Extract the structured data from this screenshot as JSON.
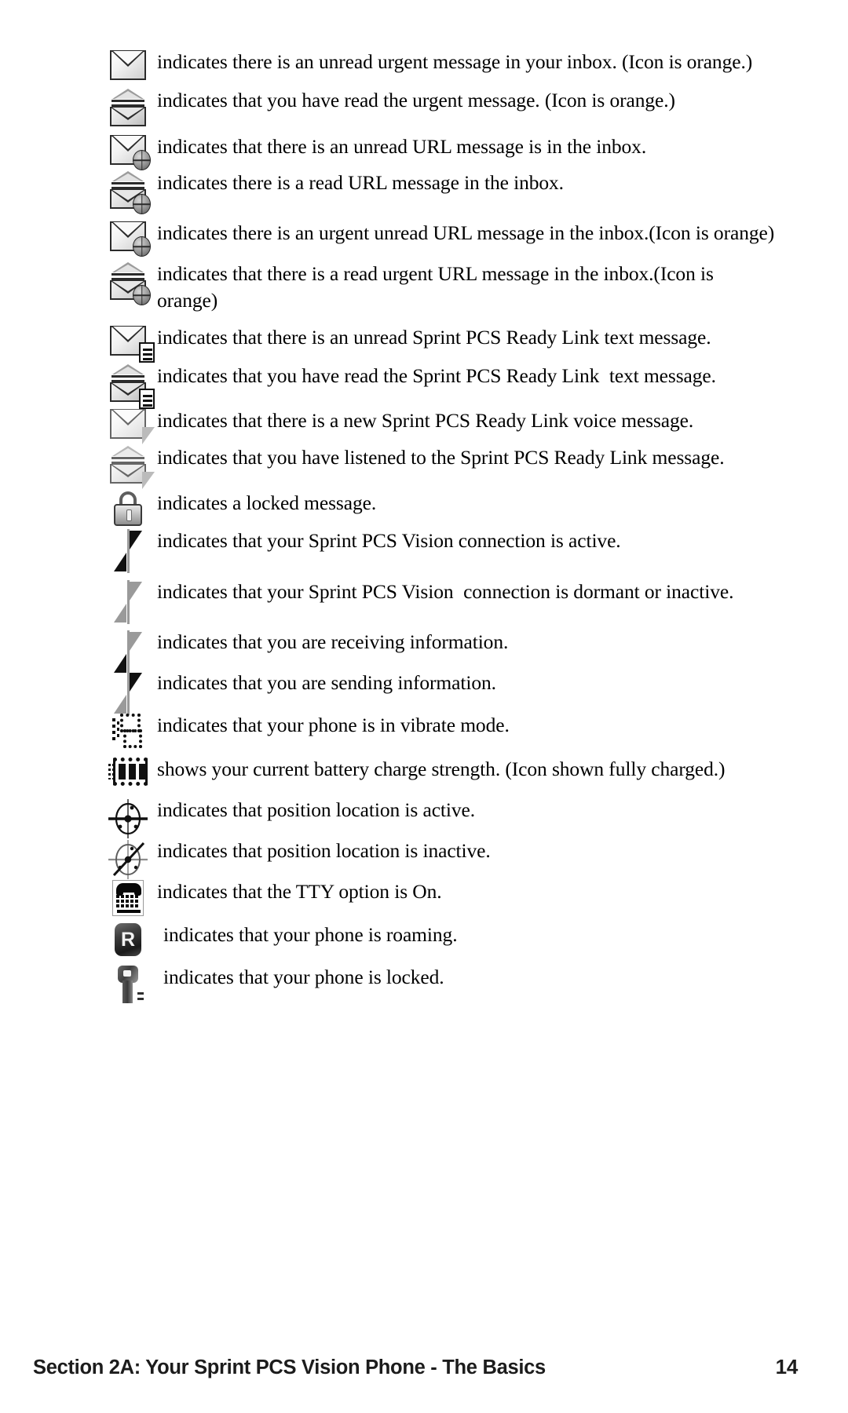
{
  "document": {
    "footer": {
      "section_title": "Section 2A: Your Sprint PCS Vision Phone - The Basics",
      "page_number": "14"
    }
  },
  "legend": {
    "entries": [
      {
        "icon": "envelope-unread-urgent-icon",
        "description": "indicates there is an unread urgent message in your inbox. (Icon is orange.)"
      },
      {
        "icon": "envelope-read-urgent-icon",
        "description": "indicates that you have read the urgent message. (Icon is orange.)"
      },
      {
        "icon": "envelope-unread-url-icon",
        "description": "indicates that there is an unread URL message is in the inbox."
      },
      {
        "icon": "envelope-read-url-icon",
        "description": "indicates there is a read URL message in the inbox."
      },
      {
        "icon": "envelope-unread-urgent-url-icon",
        "description": "indicates there is an urgent unread URL message in the inbox.(Icon is orange)"
      },
      {
        "icon": "envelope-read-urgent-url-icon",
        "description": "indicates that there is a read urgent URL message in the inbox.(Icon is orange)"
      },
      {
        "icon": "envelope-unread-readylink-text-icon",
        "description": "indicates that there is an unread Sprint PCS Ready Link text message."
      },
      {
        "icon": "envelope-read-readylink-text-icon",
        "description": "indicates that you have read the Sprint PCS Ready Link  text message."
      },
      {
        "icon": "envelope-new-readylink-voice-icon",
        "description": "indicates that there is a new Sprint PCS Ready Link voice message."
      },
      {
        "icon": "envelope-listened-readylink-voice-icon",
        "description": "indicates that you have listened to the Sprint PCS Ready Link message."
      },
      {
        "icon": "lock-icon",
        "description": "indicates a locked message."
      },
      {
        "icon": "vision-connection-active-icon",
        "description": "indicates that your Sprint PCS Vision connection is active."
      },
      {
        "icon": "vision-connection-dormant-icon",
        "description": "indicates that your Sprint PCS Vision  connection is dormant or inactive."
      },
      {
        "icon": "receiving-information-icon",
        "description": "indicates that you are receiving information."
      },
      {
        "icon": "sending-information-icon",
        "description": "indicates that you are sending information."
      },
      {
        "icon": "vibrate-mode-icon",
        "description": "indicates that your phone is in vibrate mode."
      },
      {
        "icon": "battery-icon",
        "description": "shows your current battery charge strength. (Icon shown fully charged.)"
      },
      {
        "icon": "position-location-active-icon",
        "description": "indicates that position location is active."
      },
      {
        "icon": "position-location-inactive-icon",
        "description": "indicates that position location is inactive."
      },
      {
        "icon": "tty-option-icon",
        "description": "indicates that the TTY option is On."
      },
      {
        "icon": "roaming-icon",
        "description": "indicates that your phone is roaming.",
        "glyph": "R"
      },
      {
        "icon": "phone-locked-key-icon",
        "description": "indicates that your phone is locked."
      }
    ]
  },
  "colors": {
    "text": "#000000",
    "page_background": "#ffffff",
    "icon_outline": "#2b2b2b",
    "icon_fill_light": "#f2f2f2",
    "icon_fill_dark": "#8f8f8f"
  }
}
